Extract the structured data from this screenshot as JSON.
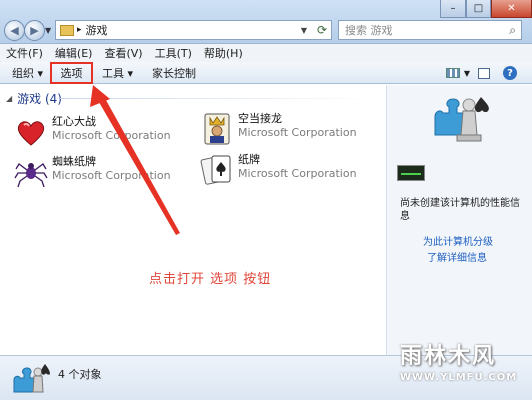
{
  "titlebar": {
    "address_path": "游戏",
    "search_placeholder": "搜索 游戏",
    "minimize": "–",
    "maximize": "□",
    "close": "✕"
  },
  "menu": [
    "文件(F)",
    "编辑(E)",
    "查看(V)",
    "工具(T)",
    "帮助(H)"
  ],
  "toolbar": {
    "organize": "组织 ▾",
    "options": "选项",
    "tools": "工具 ▾",
    "parental": "家长控制",
    "help": "?"
  },
  "group": {
    "label": "游戏 (4)"
  },
  "games": [
    {
      "name": "红心大战",
      "publisher": "Microsoft Corporation"
    },
    {
      "name": "空当接龙",
      "publisher": "Microsoft Corporation"
    },
    {
      "name": "蜘蛛纸牌",
      "publisher": "Microsoft Corporation"
    },
    {
      "name": "纸牌",
      "publisher": "Microsoft Corporation"
    }
  ],
  "annotation": {
    "text": "点击打开 选项 按钮",
    "color": "#e0463a"
  },
  "sidepane": {
    "perf_text": "尚未创建该计算机的性能信息",
    "link_rate": "为此计算机分级",
    "link_more": "了解详细信息"
  },
  "status": {
    "count": "4 个对象"
  },
  "watermark": {
    "logo": "雨林木风",
    "url": "WWW.YLMFU.COM"
  },
  "colors": {
    "highlight_border": "#e53224",
    "link": "#1e5fbf",
    "group_header": "#1e3a8a"
  }
}
